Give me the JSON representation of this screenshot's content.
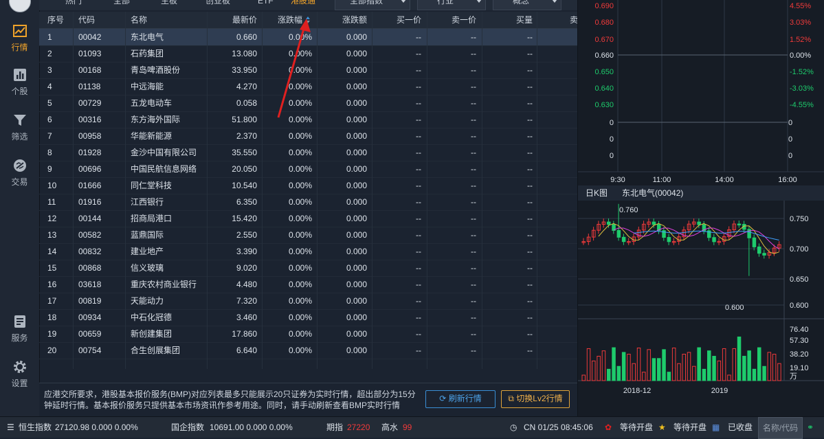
{
  "sidebar": {
    "items": [
      {
        "label": "行情",
        "icon": "chart-line-icon",
        "active": true
      },
      {
        "label": "个股",
        "icon": "bar-chart-icon",
        "active": false
      },
      {
        "label": "筛选",
        "icon": "filter-icon",
        "active": false
      },
      {
        "label": "交易",
        "icon": "exchange-icon",
        "active": false
      },
      {
        "label": "服务",
        "icon": "document-icon",
        "active": false
      },
      {
        "label": "设置",
        "icon": "gear-icon",
        "active": false
      }
    ]
  },
  "toptabs": [
    "热门",
    "全部",
    "主板",
    "创业板",
    "ETF",
    "港股通"
  ],
  "dropdowns": [
    "全部指数",
    "行业",
    "概念"
  ],
  "table": {
    "headers": [
      "序号",
      "代码",
      "名称",
      "最新价",
      "涨跌幅",
      "涨跌额",
      "买一价",
      "卖一价",
      "买量",
      "卖"
    ],
    "rows": [
      [
        "1",
        "00042",
        "东北电气",
        "0.660",
        "0.00%",
        "0.000",
        "--",
        "--",
        "--"
      ],
      [
        "2",
        "01093",
        "石药集团",
        "13.080",
        "0.00%",
        "0.000",
        "--",
        "--",
        "--"
      ],
      [
        "3",
        "00168",
        "青岛啤酒股份",
        "33.950",
        "0.00%",
        "0.000",
        "--",
        "--",
        "--"
      ],
      [
        "4",
        "01138",
        "中远海能",
        "4.270",
        "0.00%",
        "0.000",
        "--",
        "--",
        "--"
      ],
      [
        "5",
        "00729",
        "五龙电动车",
        "0.058",
        "0.00%",
        "0.000",
        "--",
        "--",
        "--"
      ],
      [
        "6",
        "00316",
        "东方海外国际",
        "51.800",
        "0.00%",
        "0.000",
        "--",
        "--",
        "--"
      ],
      [
        "7",
        "00958",
        "华能新能源",
        "2.370",
        "0.00%",
        "0.000",
        "--",
        "--",
        "--"
      ],
      [
        "8",
        "01928",
        "金沙中国有限公司",
        "35.550",
        "0.00%",
        "0.000",
        "--",
        "--",
        "--"
      ],
      [
        "9",
        "00696",
        "中国民航信息网络",
        "20.050",
        "0.00%",
        "0.000",
        "--",
        "--",
        "--"
      ],
      [
        "10",
        "01666",
        "同仁堂科技",
        "10.540",
        "0.00%",
        "0.000",
        "--",
        "--",
        "--"
      ],
      [
        "11",
        "01916",
        "江西银行",
        "6.350",
        "0.00%",
        "0.000",
        "--",
        "--",
        "--"
      ],
      [
        "12",
        "00144",
        "招商局港口",
        "15.420",
        "0.00%",
        "0.000",
        "--",
        "--",
        "--"
      ],
      [
        "13",
        "00582",
        "蓝鼎国际",
        "2.550",
        "0.00%",
        "0.000",
        "--",
        "--",
        "--"
      ],
      [
        "14",
        "00832",
        "建业地产",
        "3.390",
        "0.00%",
        "0.000",
        "--",
        "--",
        "--"
      ],
      [
        "15",
        "00868",
        "信义玻璃",
        "9.020",
        "0.00%",
        "0.000",
        "--",
        "--",
        "--"
      ],
      [
        "16",
        "03618",
        "重庆农村商业银行",
        "4.480",
        "0.00%",
        "0.000",
        "--",
        "--",
        "--"
      ],
      [
        "17",
        "00819",
        "天能动力",
        "7.320",
        "0.00%",
        "0.000",
        "--",
        "--",
        "--"
      ],
      [
        "18",
        "00934",
        "中石化冠德",
        "3.460",
        "0.00%",
        "0.000",
        "--",
        "--",
        "--"
      ],
      [
        "19",
        "00659",
        "新创建集团",
        "17.860",
        "0.00%",
        "0.000",
        "--",
        "--",
        "--"
      ],
      [
        "20",
        "00754",
        "合生创展集团",
        "6.640",
        "0.00%",
        "0.000",
        "--",
        "--",
        "--"
      ]
    ]
  },
  "notice": {
    "text": "应港交所要求，港股基本报价服务(BMP)对应列表最多只能展示20只证券为实时行情，超出部分为15分钟延时行情。基本报价服务只提供基本市场资讯作参考用途。同时，请手动刷新查看BMP实时行情",
    "refresh_label": "刷新行情",
    "lv2_label": "切换Lv2行情"
  },
  "intraday": {
    "price_ticks": [
      "0.690",
      "0.680",
      "0.670",
      "0.660",
      "0.650",
      "0.640",
      "0.630"
    ],
    "pct_ticks": [
      "4.55%",
      "3.03%",
      "1.52%",
      "0.00%",
      "-1.52%",
      "-3.03%",
      "-4.55%"
    ],
    "volume_ticks": [
      "0",
      "0",
      "0",
      "0"
    ],
    "time_ticks": [
      "9:30",
      "11:00",
      "14:00",
      "16:00"
    ],
    "colors": {
      "up": "#f03a3a",
      "down": "#1ecb6c",
      "flat": "#dde3ea"
    }
  },
  "kline": {
    "title_prefix": "日K图",
    "title_stock": "东北电气(00042)",
    "price_ticks": [
      "0.750",
      "0.700",
      "0.650",
      "0.600"
    ],
    "high_label": "0.760",
    "low_label": "0.600",
    "volume_ticks": [
      "76.40",
      "57.30",
      "38.20",
      "19.10"
    ],
    "volume_unit": "万",
    "date_ticks": [
      "2018-12",
      "2019"
    ]
  },
  "status": {
    "hsi_name": "恒生指数",
    "hsi_value": "27120.98 0.000 0.00%",
    "hscei_name": "国企指数",
    "hscei_value": "10691.00 0.000 0.00%",
    "futures_label": "期指",
    "futures_value": "27220",
    "premium_label": "高水",
    "premium_value": "99",
    "clock": "CN 01/25 08:45:06",
    "hk_status": "等待开盘",
    "cn_status": "等待开盘",
    "us_status": "已收盘",
    "search_placeholder": "名称/代码"
  }
}
